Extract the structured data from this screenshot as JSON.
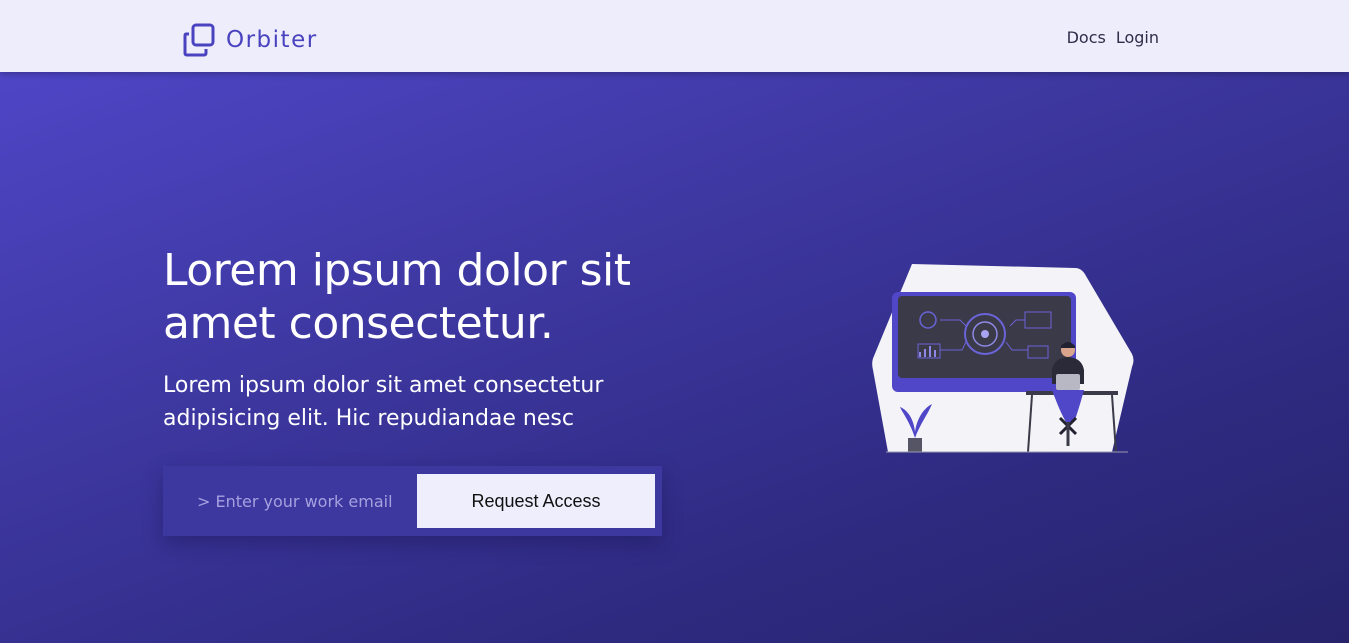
{
  "brand": {
    "name": "Orbiter",
    "icon": "copy-squares-icon",
    "color": "#4a43c0"
  },
  "nav": {
    "docs": "Docs",
    "login": "Login"
  },
  "hero": {
    "title": "Lorem ipsum dolor sit amet consectetur.",
    "subtitle": "Lorem ipsum dolor sit amet consectetur adipisicing elit. Hic repudiandae nesc"
  },
  "signup": {
    "email_placeholder": "> Enter your work email",
    "email_value": "",
    "button_label": "Request Access"
  },
  "illustration": {
    "name": "person-at-desk-dashboard-illustration"
  },
  "colors": {
    "navbar_bg": "#eeedfb",
    "hero_bg_start": "#5148cc",
    "hero_bg_end": "#27246c",
    "accent": "#4f46c8",
    "button_bg": "#efeefc"
  }
}
